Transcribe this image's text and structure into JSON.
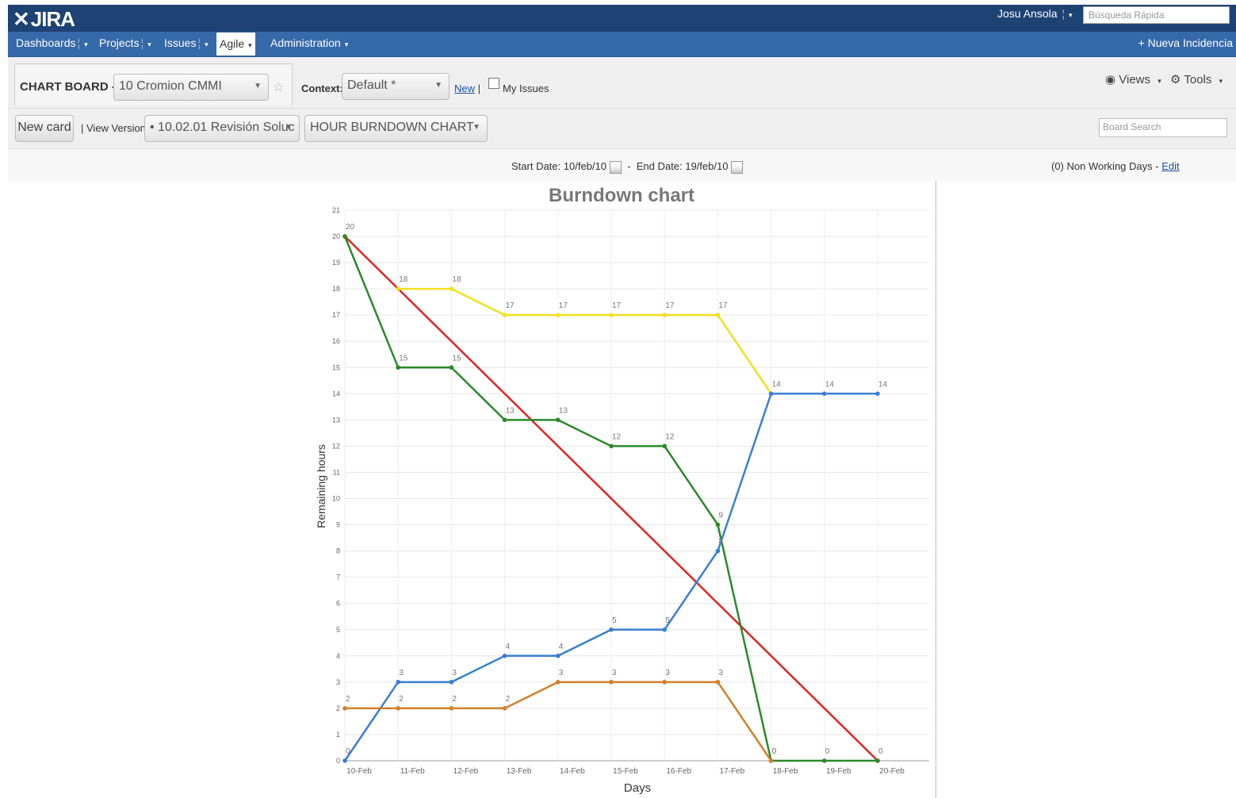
{
  "header": {
    "logo_mark": "✕",
    "logo_text": "JIRA",
    "user_name": "Josu Ansola",
    "quick_search_placeholder": "Búsqueda Rápida",
    "new_issue_label": "Nueva Incidencia"
  },
  "nav": {
    "items": [
      {
        "label": "Dashboards"
      },
      {
        "label": "Projects"
      },
      {
        "label": "Issues"
      },
      {
        "label": "Agile"
      },
      {
        "label": "Administration"
      }
    ]
  },
  "toolbar": {
    "board_title": "CHART BOARD",
    "board_select": "10 Cromion CMMI",
    "context_label": "Context:",
    "context_value": "Default *",
    "new_link": "New",
    "my_issues_label": "My Issues",
    "views_label": "Views",
    "tools_label": "Tools",
    "new_card_label": "New card",
    "view_version_label": "View Version",
    "version_value": "• 10.02.01 Revisión Soluc",
    "chart_select": "HOUR BURNDOWN CHART",
    "board_search_placeholder": "Board Search"
  },
  "dates": {
    "start_label": "Start Date:",
    "start_value": "10/feb/10",
    "end_label": "End Date:",
    "end_value": "19/feb/10",
    "non_working": "(0) Non Working Days",
    "edit_label": "Edit"
  },
  "chart_data": {
    "type": "line",
    "title": "Burndown chart",
    "xlabel": "Days",
    "ylabel": "Remaining hours",
    "categories": [
      "10-Feb",
      "11-Feb",
      "12-Feb",
      "13-Feb",
      "14-Feb",
      "15-Feb",
      "16-Feb",
      "17-Feb",
      "18-Feb",
      "19-Feb",
      "20-Feb"
    ],
    "ylim": [
      0,
      21
    ],
    "grid": true,
    "series": [
      {
        "color": "#e02424",
        "values": [
          20,
          null,
          null,
          null,
          null,
          null,
          null,
          null,
          null,
          null,
          0
        ],
        "labels": [
          true,
          false,
          false,
          false,
          false,
          false,
          false,
          false,
          false,
          false,
          true
        ]
      },
      {
        "color": "#f0e020",
        "values": [
          null,
          18,
          18,
          17,
          17,
          17,
          17,
          17,
          14,
          null,
          null
        ],
        "labels": [
          false,
          true,
          true,
          true,
          true,
          true,
          true,
          true,
          true,
          false,
          false
        ]
      },
      {
        "color": "#2a8a2a",
        "values": [
          20,
          15,
          15,
          13,
          13,
          12,
          12,
          9,
          0,
          0,
          0
        ],
        "labels": [
          false,
          true,
          true,
          true,
          true,
          true,
          true,
          true,
          true,
          true,
          false
        ]
      },
      {
        "color": "#3a7fd0",
        "values": [
          0,
          3,
          3,
          4,
          4,
          5,
          5,
          8,
          14,
          14,
          14
        ],
        "labels": [
          true,
          true,
          true,
          true,
          true,
          true,
          true,
          true,
          false,
          true,
          true
        ]
      },
      {
        "color": "#d0802a",
        "values": [
          2,
          2,
          2,
          2,
          3,
          3,
          3,
          3,
          0,
          null,
          null
        ],
        "labels": [
          true,
          true,
          true,
          true,
          true,
          true,
          true,
          true,
          true,
          false,
          false
        ]
      }
    ]
  }
}
